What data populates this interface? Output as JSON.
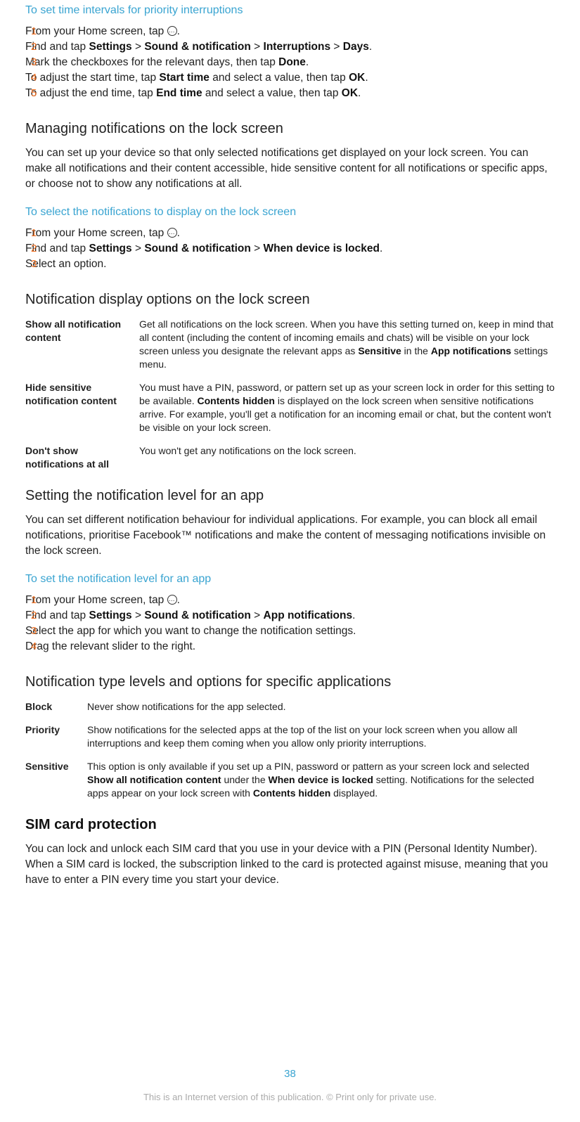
{
  "sec1": {
    "title": "To set time intervals for priority interruptions",
    "steps": {
      "1": "From your Home screen, tap ",
      "2a": "Find and tap ",
      "2b": "Settings",
      "2c": " > ",
      "2d": "Sound & notification",
      "2e": " > ",
      "2f": "Interruptions",
      "2g": " > ",
      "2h": "Days",
      "2i": ".",
      "3a": "Mark the checkboxes for the relevant days, then tap ",
      "3b": "Done",
      "3c": ".",
      "4a": "To adjust the start time, tap ",
      "4b": "Start time",
      "4c": " and select a value, then tap ",
      "4d": "OK",
      "4e": ".",
      "5a": "To adjust the end time, tap ",
      "5b": "End time",
      "5c": " and select a value, then tap ",
      "5d": "OK",
      "5e": "."
    }
  },
  "sec2": {
    "heading": "Managing notifications on the lock screen",
    "para": "You can set up your device so that only selected notifications get displayed on your lock screen. You can make all notifications and their content accessible, hide sensitive content for all notifications or specific apps, or choose not to show any notifications at all."
  },
  "sec3": {
    "title": "To select the notifications to display on the lock screen",
    "steps": {
      "1": "From your Home screen, tap ",
      "2a": "Find and tap ",
      "2b": "Settings",
      "2c": " > ",
      "2d": "Sound & notification",
      "2e": " > ",
      "2f": "When device is locked",
      "2g": ".",
      "3": "Select an option."
    }
  },
  "sec4": {
    "heading": "Notification display options on the lock screen",
    "rows": {
      "r1label": "Show all notification content",
      "r1a": "Get all notifications on the lock screen. When you have this setting turned on, keep in mind that all content (including the content of incoming emails and chats) will be visible on your lock screen unless you designate the relevant apps as ",
      "r1b": "Sensitive",
      "r1c": " in the ",
      "r1d": "App notifications",
      "r1e": " settings menu.",
      "r2label": "Hide sensitive notification content",
      "r2a": "You must have a PIN, password, or pattern set up as your screen lock in order for this setting to be available. ",
      "r2b": "Contents hidden",
      "r2c": " is displayed on the lock screen when sensitive notifications arrive. For example, you'll get a notification for an incoming email or chat, but the content won't be visible on your lock screen.",
      "r3label": "Don't show notifications at all",
      "r3": "You won't get any notifications on the lock screen."
    }
  },
  "sec5": {
    "heading": "Setting the notification level for an app",
    "para": "You can set different notification behaviour for individual applications. For example, you can block all email notifications, prioritise Facebook™ notifications and make the content of messaging notifications invisible on the lock screen."
  },
  "sec6": {
    "title": "To set the notification level for an app",
    "steps": {
      "1": "From your Home screen, tap ",
      "2a": "Find and tap ",
      "2b": "Settings",
      "2c": " > ",
      "2d": "Sound & notification",
      "2e": " > ",
      "2f": "App notifications",
      "2g": ".",
      "3": "Select the app for which you want to change the notification settings.",
      "4": "Drag the relevant slider to the right."
    }
  },
  "sec7": {
    "heading": "Notification type levels and options for specific applications",
    "rows": {
      "r1label": "Block",
      "r1": "Never show notifications for the app selected.",
      "r2label": "Priority",
      "r2": "Show notifications for the selected apps at the top of the list on your lock screen when you allow all interruptions and keep them coming when you allow only priority interruptions.",
      "r3label": "Sensitive",
      "r3a": "This option is only available if you set up a PIN, password or pattern as your screen lock and selected ",
      "r3b": "Show all notification content",
      "r3c": " under the ",
      "r3d": "When device is locked",
      "r3e": " setting. Notifications for the selected apps appear on your lock screen with ",
      "r3f": "Contents hidden",
      "r3g": " displayed."
    }
  },
  "sec8": {
    "heading": "SIM card protection",
    "para": "You can lock and unlock each SIM card that you use in your device with a PIN (Personal Identity Number). When a SIM card is locked, the subscription linked to the card is protected against misuse, meaning that you have to enter a PIN every time you start your device."
  },
  "page_number": "38",
  "footer": "This is an Internet version of this publication. © Print only for private use."
}
